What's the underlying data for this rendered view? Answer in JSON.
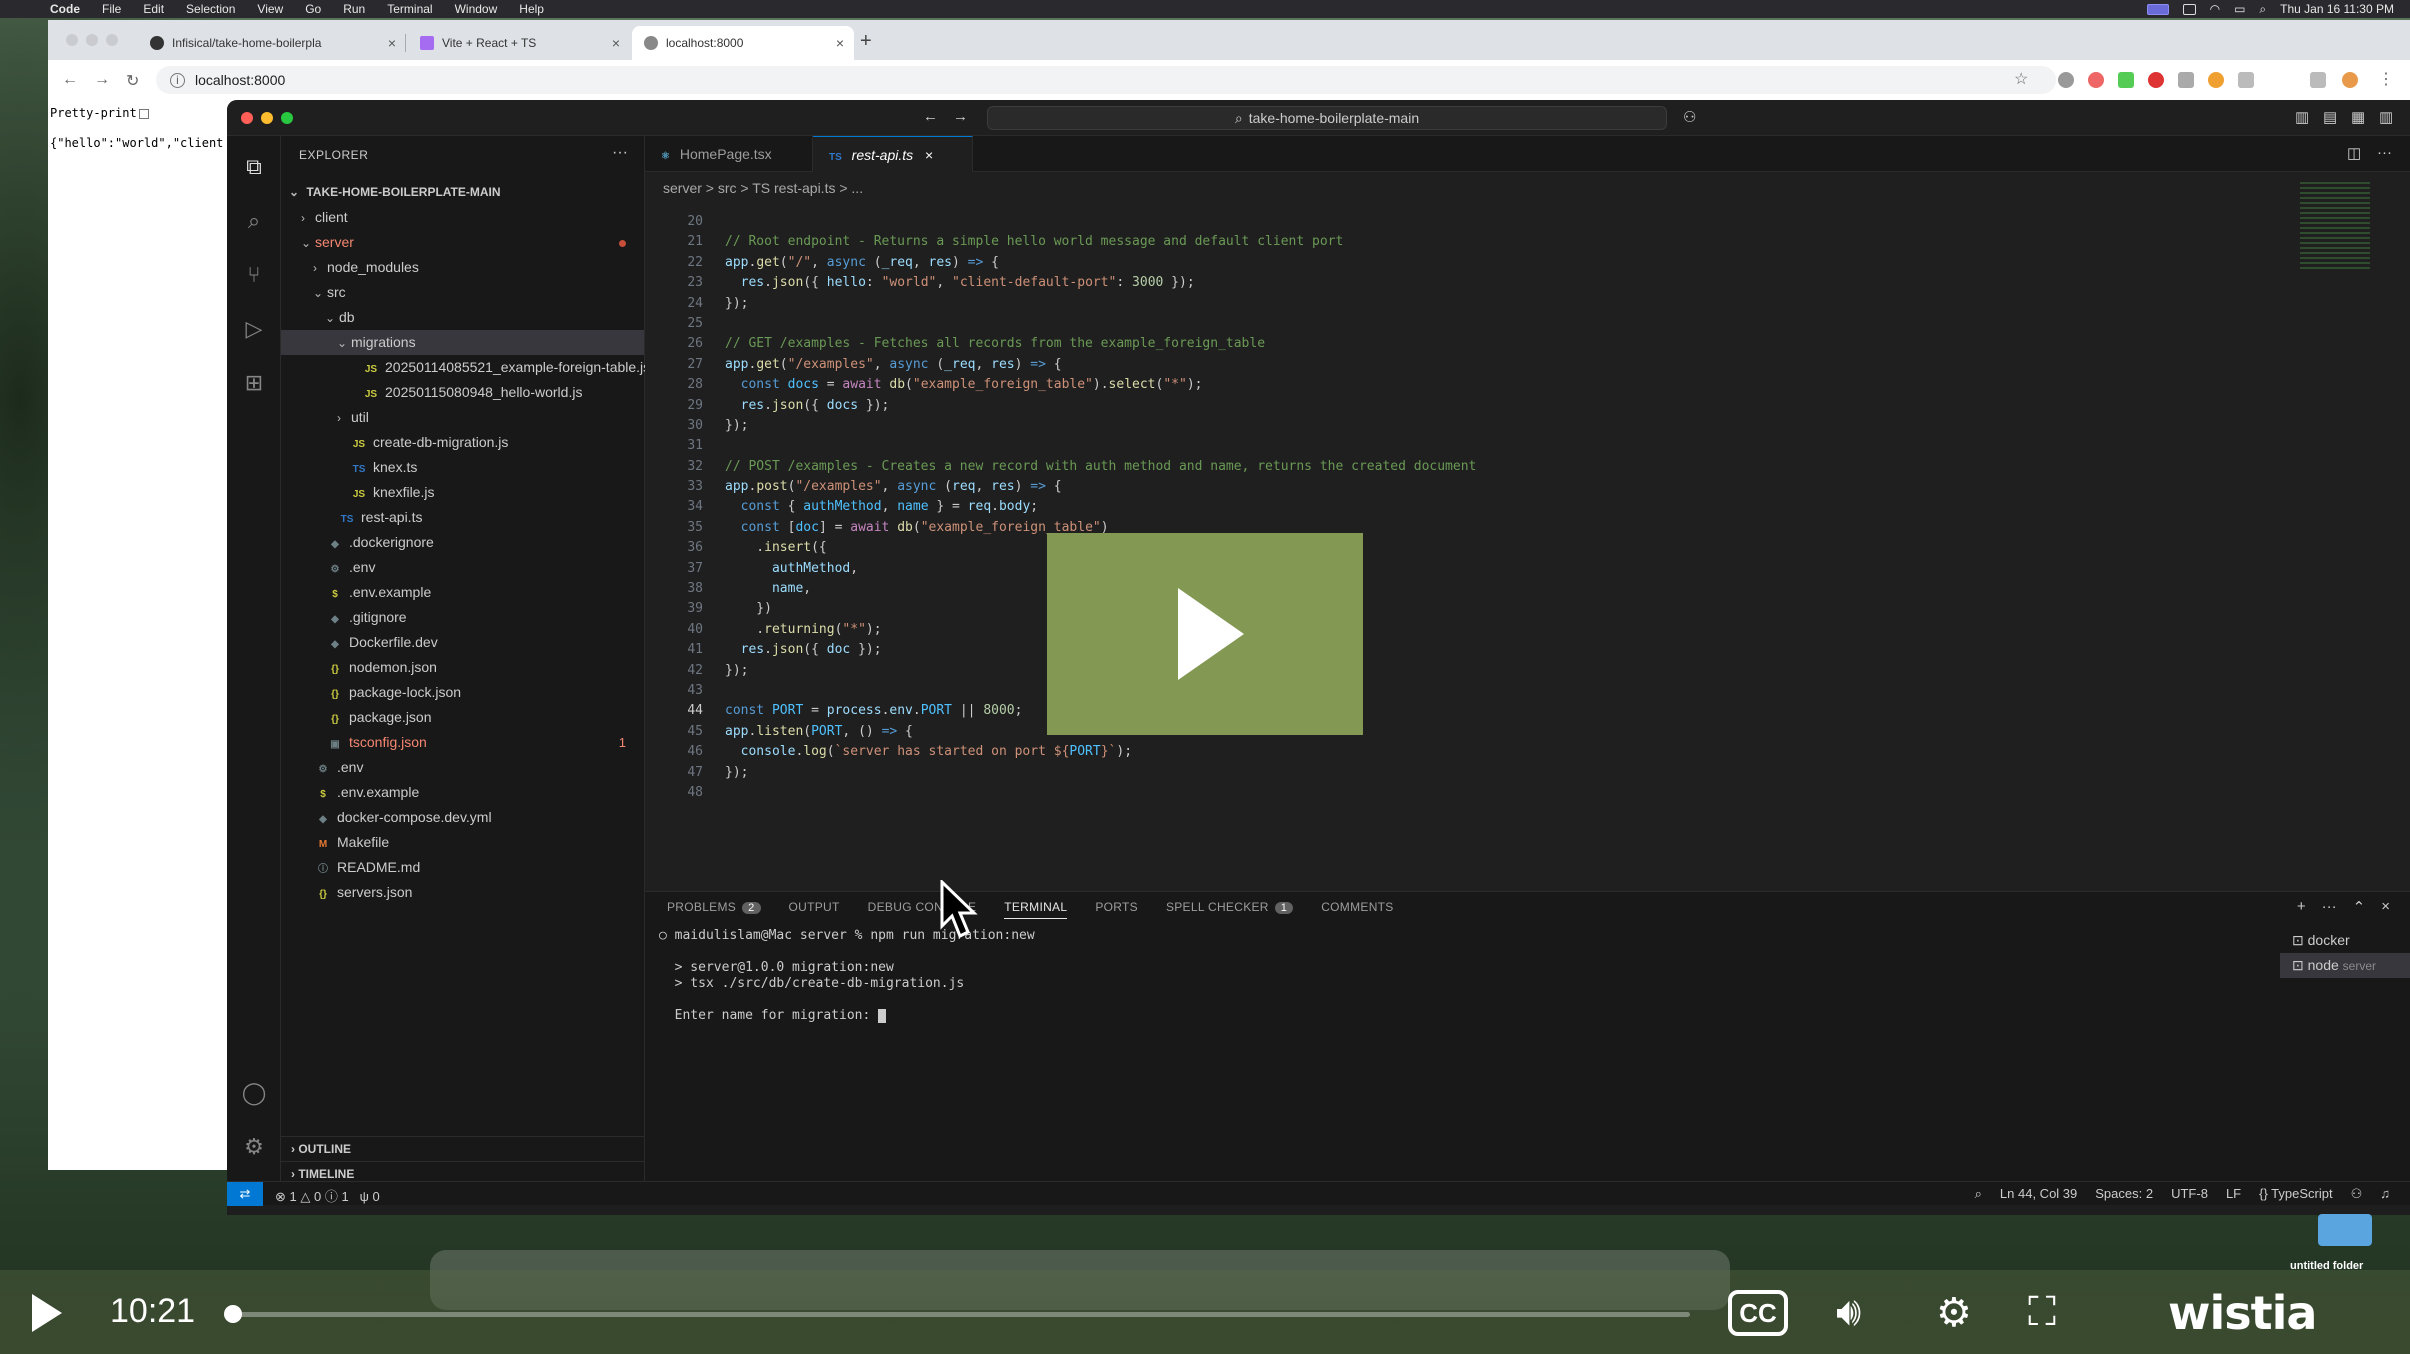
{
  "menubar": {
    "app": "Code",
    "items": [
      "File",
      "Edit",
      "Selection",
      "View",
      "Go",
      "Run",
      "Terminal",
      "Window",
      "Help"
    ],
    "clock": "Thu Jan 16  11:30 PM"
  },
  "browser": {
    "tabs": [
      {
        "title": "Infisical/take-home-boilerpla"
      },
      {
        "title": "Vite + React + TS"
      },
      {
        "title": "localhost:8000"
      }
    ],
    "url": "localhost:8000",
    "page": {
      "pretty_print_label": "Pretty-print",
      "json_text": "{\"hello\":\"world\",\"client"
    }
  },
  "vscode": {
    "search_text": "take-home-boilerplate-main",
    "explorer": {
      "header": "EXPLORER",
      "root": "TAKE-HOME-BOILERPLATE-MAIN",
      "items": [
        {
          "label": "client",
          "indent": 1,
          "type": "folder",
          "open": false,
          "icon": ""
        },
        {
          "label": "server",
          "indent": 1,
          "type": "folder",
          "open": true,
          "icon": "",
          "status": "dot",
          "red": true
        },
        {
          "label": "node_modules",
          "indent": 2,
          "type": "folder",
          "open": false,
          "icon": ""
        },
        {
          "label": "src",
          "indent": 2,
          "type": "folder",
          "open": true,
          "icon": ""
        },
        {
          "label": "db",
          "indent": 3,
          "type": "folder",
          "open": true,
          "icon": ""
        },
        {
          "label": "migrations",
          "indent": 4,
          "type": "folder",
          "open": true,
          "icon": "",
          "selected": true
        },
        {
          "label": "20250114085521_example-foreign-table.js",
          "indent": 5,
          "type": "file",
          "icon": "JS"
        },
        {
          "label": "20250115080948_hello-world.js",
          "indent": 5,
          "type": "file",
          "icon": "JS"
        },
        {
          "label": "util",
          "indent": 4,
          "type": "folder",
          "open": false,
          "icon": ""
        },
        {
          "label": "create-db-migration.js",
          "indent": 4,
          "type": "file",
          "icon": "JS"
        },
        {
          "label": "knex.ts",
          "indent": 4,
          "type": "file",
          "icon": "TS"
        },
        {
          "label": "knexfile.js",
          "indent": 4,
          "type": "file",
          "icon": "JS"
        },
        {
          "label": "rest-api.ts",
          "indent": 3,
          "type": "file",
          "icon": "TS"
        },
        {
          "label": ".dockerignore",
          "indent": 2,
          "type": "file",
          "icon": "◆"
        },
        {
          "label": ".env",
          "indent": 2,
          "type": "file",
          "icon": "⚙"
        },
        {
          "label": ".env.example",
          "indent": 2,
          "type": "file",
          "icon": "$"
        },
        {
          "label": ".gitignore",
          "indent": 2,
          "type": "file",
          "icon": "◆"
        },
        {
          "label": "Dockerfile.dev",
          "indent": 2,
          "type": "file",
          "icon": "◆"
        },
        {
          "label": "nodemon.json",
          "indent": 2,
          "type": "file",
          "icon": "{}"
        },
        {
          "label": "package-lock.json",
          "indent": 2,
          "type": "file",
          "icon": "{}"
        },
        {
          "label": "package.json",
          "indent": 2,
          "type": "file",
          "icon": "{}"
        },
        {
          "label": "tsconfig.json",
          "indent": 2,
          "type": "file",
          "icon": "▣",
          "red": true,
          "count": "1"
        },
        {
          "label": ".env",
          "indent": 1,
          "type": "file",
          "icon": "⚙"
        },
        {
          "label": ".env.example",
          "indent": 1,
          "type": "file",
          "icon": "$"
        },
        {
          "label": "docker-compose.dev.yml",
          "indent": 1,
          "type": "file",
          "icon": "◆"
        },
        {
          "label": "Makefile",
          "indent": 1,
          "type": "file",
          "icon": "M"
        },
        {
          "label": "README.md",
          "indent": 1,
          "type": "file",
          "icon": "ⓘ"
        },
        {
          "label": "servers.json",
          "indent": 1,
          "type": "file",
          "icon": "{}"
        }
      ],
      "outline": "OUTLINE",
      "timeline": "TIMELINE"
    },
    "editor_tabs": [
      {
        "label": "HomePage.tsx",
        "active": false
      },
      {
        "label": "rest-api.ts",
        "active": true
      }
    ],
    "breadcrumbs": "server  >  src  >  TS rest-api.ts  >  ...",
    "current_line": 44,
    "code_lines": [
      {
        "n": 20,
        "html": ""
      },
      {
        "n": 21,
        "html": "<span class='cm'>// Root endpoint - Returns a simple hello world message and default client port</span>"
      },
      {
        "n": 22,
        "html": "<span class='vr'>app</span>.<span class='fn'>get</span>(<span class='st'>\"/\"</span>, <span class='kw'>async</span> (<span class='vr'>_req</span>, <span class='vr'>res</span>) <span class='kw'>=&gt;</span> {"
      },
      {
        "n": 23,
        "html": "  <span class='vr'>res</span>.<span class='fn'>json</span>({ <span class='vr'>hello</span>: <span class='st'>\"world\"</span>, <span class='st'>\"client-default-port\"</span>: <span class='nm'>3000</span> });"
      },
      {
        "n": 24,
        "html": "});"
      },
      {
        "n": 25,
        "html": ""
      },
      {
        "n": 26,
        "html": "<span class='cm'>// GET /examples - Fetches all records from the example_foreign_table</span>"
      },
      {
        "n": 27,
        "html": "<span class='vr'>app</span>.<span class='fn'>get</span>(<span class='st'>\"/examples\"</span>, <span class='kw'>async</span> (<span class='vr'>_req</span>, <span class='vr'>res</span>) <span class='kw'>=&gt;</span> {"
      },
      {
        "n": 28,
        "html": "  <span class='kw'>const</span> <span class='cn'>docs</span> = <span class='kw2'>await</span> <span class='fn'>db</span>(<span class='st'>\"example_foreign_table\"</span>).<span class='fn'>select</span>(<span class='st'>\"*\"</span>);"
      },
      {
        "n": 29,
        "html": "  <span class='vr'>res</span>.<span class='fn'>json</span>({ <span class='vr'>docs</span> });"
      },
      {
        "n": 30,
        "html": "});"
      },
      {
        "n": 31,
        "html": ""
      },
      {
        "n": 32,
        "html": "<span class='cm'>// POST /examples - Creates a new record with auth method and name, returns the created document</span>"
      },
      {
        "n": 33,
        "html": "<span class='vr'>app</span>.<span class='fn'>post</span>(<span class='st'>\"/examples\"</span>, <span class='kw'>async</span> (<span class='vr'>req</span>, <span class='vr'>res</span>) <span class='kw'>=&gt;</span> {"
      },
      {
        "n": 34,
        "html": "  <span class='kw'>const</span> { <span class='cn'>authMethod</span>, <span class='cn'>name</span> } = <span class='vr'>req</span>.<span class='vr'>body</span>;"
      },
      {
        "n": 35,
        "html": "  <span class='kw'>const</span> [<span class='cn'>doc</span>] = <span class='kw2'>await</span> <span class='fn'>db</span>(<span class='st'>\"example_foreign_table\"</span>)"
      },
      {
        "n": 36,
        "html": "    .<span class='fn'>insert</span>({"
      },
      {
        "n": 37,
        "html": "      <span class='vr'>authMethod</span>,"
      },
      {
        "n": 38,
        "html": "      <span class='vr'>name</span>,"
      },
      {
        "n": 39,
        "html": "    })"
      },
      {
        "n": 40,
        "html": "    .<span class='fn'>returning</span>(<span class='st'>\"*\"</span>);"
      },
      {
        "n": 41,
        "html": "  <span class='vr'>res</span>.<span class='fn'>json</span>({ <span class='vr'>doc</span> });"
      },
      {
        "n": 42,
        "html": "});"
      },
      {
        "n": 43,
        "html": ""
      },
      {
        "n": 44,
        "html": "<span class='kw'>const</span> <span class='cn'>PORT</span> = <span class='vr'>process</span>.<span class='vr'>env</span>.<span class='cn'>PORT</span> || <span class='nm'>8000</span>;"
      },
      {
        "n": 45,
        "html": "<span class='vr'>app</span>.<span class='fn'>listen</span>(<span class='cn'>PORT</span>, () <span class='kw'>=&gt;</span> {"
      },
      {
        "n": 46,
        "html": "  <span class='vr'>console</span>.<span class='fn'>log</span>(<span class='st'>`server has started on port ${</span><span class='cn'>PORT</span><span class='st'>}`</span>);"
      },
      {
        "n": 47,
        "html": "});"
      },
      {
        "n": 48,
        "html": ""
      }
    ],
    "panel": {
      "tabs": [
        {
          "label": "PROBLEMS",
          "badge": "2"
        },
        {
          "label": "OUTPUT"
        },
        {
          "label": "DEBUG CONSOLE"
        },
        {
          "label": "TERMINAL",
          "active": true
        },
        {
          "label": "PORTS"
        },
        {
          "label": "SPELL CHECKER",
          "badge": "1"
        },
        {
          "label": "COMMENTS"
        }
      ],
      "terminal_lines": [
        "maidulislam@Mac server % npm run migration:new",
        "",
        "> server@1.0.0 migration:new",
        "> tsx ./src/db/create-db-migration.js",
        "",
        "Enter name for migration: "
      ],
      "terminals": [
        {
          "name": "docker",
          "sub": ""
        },
        {
          "name": "node",
          "sub": "server"
        }
      ]
    },
    "status": {
      "errors": "1",
      "warnings": "0",
      "info": "1",
      "ports": "0",
      "position": "Ln 44, Col 39",
      "spaces": "Spaces: 2",
      "encoding": "UTF-8",
      "eol": "LF",
      "language": "TypeScript"
    }
  },
  "player": {
    "time": "10:21",
    "progress": 0.005,
    "brand": "wistia",
    "cc_label": "CC",
    "folder_label": "untitled folder"
  },
  "colors": {
    "accent": "#0078d4",
    "play_overlay": "#889f56"
  }
}
